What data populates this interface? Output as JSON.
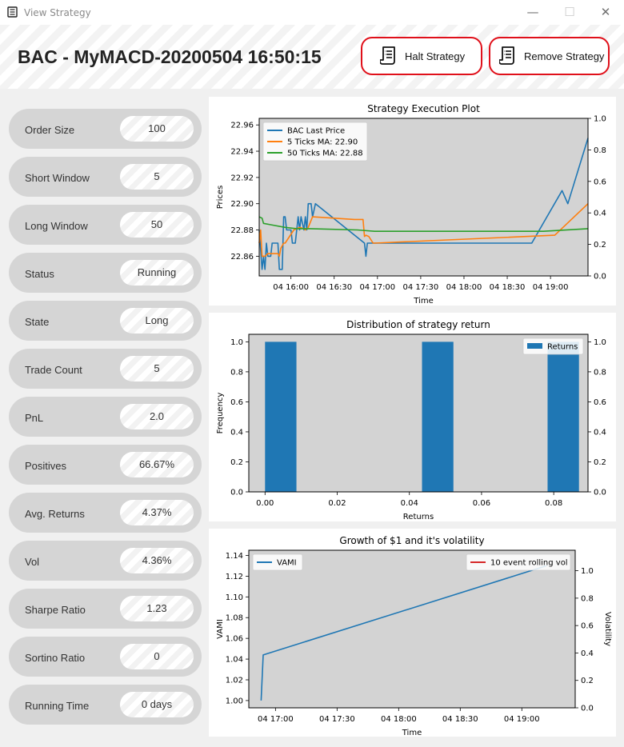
{
  "window": {
    "title": "View Strategy",
    "minimize": "—",
    "maximize": "☐",
    "close": "✕"
  },
  "header": {
    "title": "BAC - MyMACD-20200504 16:50:15",
    "halt_label": "Halt Strategy",
    "remove_label": "Remove Strategy",
    "button_border_color": "#e0101a"
  },
  "stats": [
    {
      "label": "Order Size",
      "value": "100"
    },
    {
      "label": "Short Window",
      "value": "5"
    },
    {
      "label": "Long Window",
      "value": "50"
    },
    {
      "label": "Status",
      "value": "Running"
    },
    {
      "label": "State",
      "value": "Long"
    },
    {
      "label": "Trade Count",
      "value": "5"
    },
    {
      "label": "PnL",
      "value": "2.0"
    },
    {
      "label": "Positives",
      "value": "66.67%"
    },
    {
      "label": "Avg. Returns",
      "value": "4.37%"
    },
    {
      "label": "Vol",
      "value": "4.36%"
    },
    {
      "label": "Sharpe Ratio",
      "value": "1.23"
    },
    {
      "label": "Sortino Ratio",
      "value": "0"
    },
    {
      "label": "Running Time",
      "value": "0 days"
    }
  ],
  "chart_data": [
    {
      "type": "line",
      "title": "Strategy Execution Plot",
      "xlabel": "Time",
      "ylabel": "Prices",
      "x_ticks": [
        "04 16:00",
        "04 16:30",
        "04 17:00",
        "04 17:30",
        "04 18:00",
        "04 18:30",
        "04 19:00"
      ],
      "xlim": [
        "15:38",
        "19:26"
      ],
      "ylim": [
        22.845,
        22.965
      ],
      "y_ticks": [
        "22.86",
        "22.88",
        "22.90",
        "22.92",
        "22.94",
        "22.96"
      ],
      "y2_ticks": [
        "0.0",
        "0.2",
        "0.4",
        "0.6",
        "0.8",
        "1.0"
      ],
      "background": "#d3d3d3",
      "legend_position": "upper left",
      "series": [
        {
          "name": "BAC Last Price",
          "color": "#1f77b4",
          "x": [
            "15:38",
            "15:40",
            "15:41",
            "15:42",
            "15:43",
            "15:44",
            "15:46",
            "15:47",
            "15:51",
            "15:52",
            "15:54",
            "15:55",
            "15:56",
            "15:57",
            "16:00",
            "16:01",
            "16:03",
            "16:05",
            "16:06",
            "16:07",
            "16:09",
            "16:10",
            "16:11",
            "16:12",
            "16:14",
            "16:15",
            "16:17",
            "16:51",
            "16:52",
            "16:53",
            "18:47",
            "19:08",
            "19:12",
            "19:26"
          ],
          "values": [
            22.88,
            22.85,
            22.86,
            22.85,
            22.87,
            22.86,
            22.86,
            22.87,
            22.87,
            22.85,
            22.85,
            22.89,
            22.89,
            22.88,
            22.88,
            22.87,
            22.87,
            22.89,
            22.88,
            22.89,
            22.88,
            22.89,
            22.88,
            22.9,
            22.9,
            22.89,
            22.9,
            22.87,
            22.86,
            22.87,
            22.87,
            22.91,
            22.9,
            22.95
          ]
        },
        {
          "name": "5 Ticks MA: 22.90",
          "color": "#ff7f0e",
          "x": [
            "15:38",
            "15:39",
            "15:40",
            "15:42",
            "15:44",
            "15:51",
            "15:52",
            "15:53",
            "15:55",
            "15:56",
            "16:02",
            "16:06",
            "16:09",
            "16:10",
            "16:12",
            "16:15",
            "16:44",
            "16:50",
            "16:51",
            "16:52",
            "16:54",
            "16:57",
            "16:58",
            "19:03",
            "19:26"
          ],
          "values": [
            22.87,
            22.88,
            22.86,
            22.86,
            22.862,
            22.862,
            22.86,
            22.866,
            22.87,
            22.87,
            22.88,
            22.882,
            22.881,
            22.88,
            22.882,
            22.89,
            22.888,
            22.888,
            22.875,
            22.876,
            22.875,
            22.87,
            22.87,
            22.876,
            22.9
          ]
        },
        {
          "name": "50 Ticks MA: 22.88",
          "color": "#2ca02c",
          "x": [
            "15:38",
            "15:40",
            "15:41",
            "15:46",
            "15:56",
            "16:04",
            "16:13",
            "16:46",
            "16:58",
            "18:55",
            "19:26"
          ],
          "values": [
            22.89,
            22.889,
            22.885,
            22.884,
            22.882,
            22.881,
            22.881,
            22.88,
            22.879,
            22.879,
            22.881
          ]
        }
      ]
    },
    {
      "type": "bar",
      "title": "Distribution of strategy return",
      "xlabel": "Returns",
      "ylabel": "Frequency",
      "x_ticks": [
        "0.00",
        "0.02",
        "0.04",
        "0.06",
        "0.08"
      ],
      "y_ticks": [
        "0.0",
        "0.2",
        "0.4",
        "0.6",
        "0.8",
        "1.0"
      ],
      "y2_ticks": [
        "0.0",
        "0.2",
        "0.4",
        "0.6",
        "0.8",
        "1.0"
      ],
      "xlim": [
        -0.0045,
        0.0895
      ],
      "ylim": [
        0,
        1.05
      ],
      "background": "#d3d3d3",
      "legend_position": "upper right",
      "series": [
        {
          "name": "Returns",
          "color": "#1f77b4",
          "bins": [
            [
              0.0,
              0.0087
            ],
            [
              0.0435,
              0.0522
            ],
            [
              0.0783,
              0.087
            ]
          ],
          "values": [
            1,
            1,
            1
          ]
        }
      ]
    },
    {
      "type": "line",
      "title": "Growth of $1 and it's volatility",
      "xlabel": "Time",
      "ylabel": "VAMI",
      "y2label": "Volatility",
      "x_ticks": [
        "04 17:00",
        "04 17:30",
        "04 18:00",
        "04 18:30",
        "04 19:00"
      ],
      "xlim": [
        "16:47",
        "19:26"
      ],
      "ylim": [
        0.993,
        1.145
      ],
      "y_ticks": [
        "1.00",
        "1.02",
        "1.04",
        "1.06",
        "1.08",
        "1.10",
        "1.12",
        "1.14"
      ],
      "y2_ticks": [
        "0.0",
        "0.2",
        "0.4",
        "0.6",
        "0.8",
        "1.0"
      ],
      "background": "#d3d3d3",
      "series": [
        {
          "name": "VAMI",
          "color": "#1f77b4",
          "legend_position": "upper left",
          "x": [
            "16:53",
            "16:54",
            "19:12"
          ],
          "values": [
            1.0,
            1.044,
            1.13
          ]
        },
        {
          "name": "10 event rolling vol",
          "color": "#d62728",
          "legend_position": "upper right",
          "x": [],
          "values": []
        }
      ]
    }
  ]
}
